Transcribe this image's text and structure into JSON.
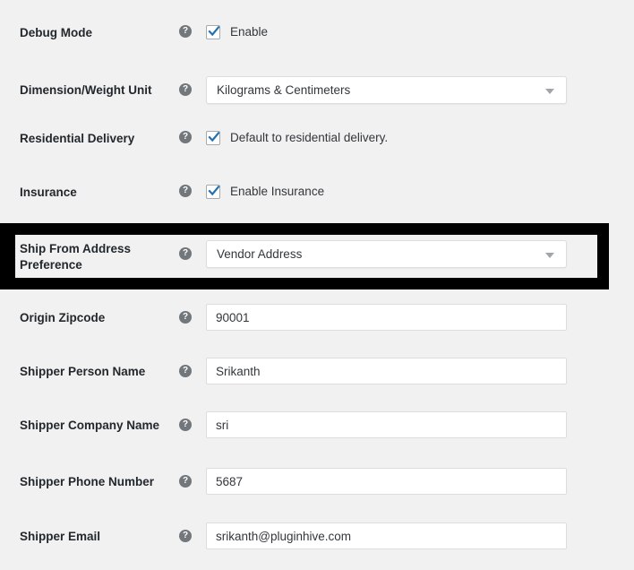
{
  "page": {
    "background_color": "#f1f1f1",
    "label_color": "#23282d",
    "value_color": "#32373c",
    "accent_checkbox_color": "#2271b1",
    "highlight_color": "#000000"
  },
  "icons": {
    "help": "help-icon",
    "checkmark": "check-icon",
    "dropdown_arrow": "chevron-down-icon"
  },
  "fields": [
    {
      "id": "debug-mode",
      "label": "Debug Mode",
      "type": "checkbox",
      "checked": true,
      "checkbox_label": "Enable"
    },
    {
      "id": "dimension-weight-unit",
      "label": "Dimension/Weight Unit",
      "type": "select",
      "value": "Kilograms & Centimeters"
    },
    {
      "id": "residential-delivery",
      "label": "Residential Delivery",
      "type": "checkbox",
      "checked": true,
      "checkbox_label": "Default to residential delivery."
    },
    {
      "id": "insurance",
      "label": "Insurance",
      "type": "checkbox",
      "checked": true,
      "checkbox_label": "Enable Insurance"
    },
    {
      "id": "ship-from-address-preference",
      "label": "Ship From Address Preference",
      "type": "select",
      "value": "Vendor Address",
      "highlighted": true
    },
    {
      "id": "origin-zipcode",
      "label": "Origin Zipcode",
      "type": "text",
      "value": "90001"
    },
    {
      "id": "shipper-person-name",
      "label": "Shipper Person Name",
      "type": "text",
      "value": "Srikanth"
    },
    {
      "id": "shipper-company-name",
      "label": "Shipper Company Name",
      "type": "text",
      "value": "sri"
    },
    {
      "id": "shipper-phone-number",
      "label": "Shipper Phone Number",
      "type": "text",
      "value": "5687"
    },
    {
      "id": "shipper-email",
      "label": "Shipper Email",
      "type": "text",
      "value": "srikanth@pluginhive.com"
    }
  ]
}
